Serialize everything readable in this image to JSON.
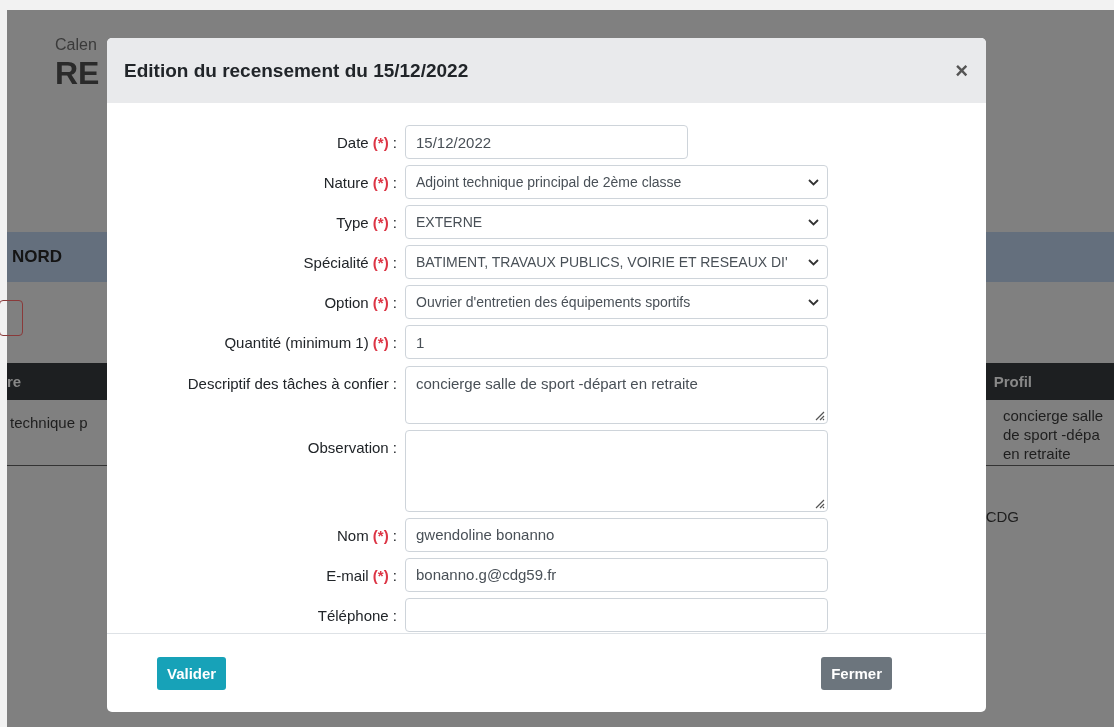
{
  "background_page": {
    "breadcrumb": "Calen",
    "heading": "RE",
    "band_title": "NORD",
    "table": {
      "columns": [
        "re",
        "Profil"
      ],
      "row": [
        "technique p",
        "concierge salle\nde sport -dépa\nen retraite"
      ]
    },
    "footer_text": "CDG"
  },
  "dialog": {
    "title": "Edition du recensement du 15/12/2022",
    "close": "×",
    "fields": [
      {
        "kind": "date",
        "label": "Date",
        "mark": "(*)",
        "suffix": ":",
        "value": "15/12/2022"
      },
      {
        "kind": "select",
        "label": "Nature",
        "mark": "(*)",
        "suffix": ":",
        "value": "Adjoint technique principal de 2ème classe"
      },
      {
        "kind": "select",
        "label": "Type",
        "mark": "(*)",
        "suffix": ":",
        "value": "EXTERNE"
      },
      {
        "kind": "select",
        "label": "Spécialité",
        "mark": "(*)",
        "suffix": ":",
        "value": "BATIMENT, TRAVAUX PUBLICS, VOIRIE ET RESEAUX DI'"
      },
      {
        "kind": "select",
        "label": "Option",
        "mark": "(*)",
        "suffix": ":",
        "value": "Ouvrier d'entretien des équipements sportifs"
      },
      {
        "kind": "text",
        "label": "Quantité (minimum 1)",
        "mark": "(*)",
        "suffix": ":",
        "value": "1"
      },
      {
        "kind": "textarea",
        "label": "Descriptif des tâches à confier :",
        "value": "concierge salle de sport -départ en retraite"
      },
      {
        "kind": "textarea_tall",
        "label": "Observation :"
      },
      {
        "kind": "text",
        "label": "Nom",
        "mark": "(*)",
        "suffix": ":",
        "value": "gwendoline bonanno"
      },
      {
        "kind": "text",
        "label": "E-mail",
        "mark": "(*)",
        "suffix": ":",
        "value": "bonanno.g@cdg59.fr"
      },
      {
        "kind": "text",
        "label": "Téléphone :"
      }
    ],
    "buttons": [
      {
        "kind": "primary",
        "label": "Valider"
      },
      {
        "kind": "secondary",
        "label": "Fermer"
      }
    ]
  }
}
